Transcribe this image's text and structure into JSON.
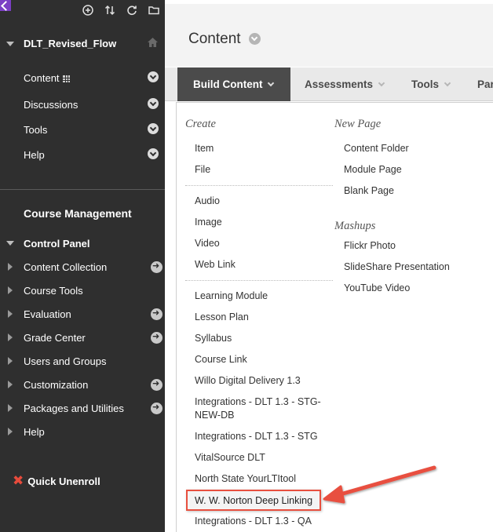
{
  "sidebar": {
    "course_title": "DLT_Revised_Flow",
    "course_menu": [
      {
        "label": "Content"
      },
      {
        "label": "Discussions"
      },
      {
        "label": "Tools"
      },
      {
        "label": "Help"
      }
    ],
    "course_management_title": "Course Management",
    "control_panel_title": "Control Panel",
    "control_panel_items": [
      {
        "label": "Content Collection"
      },
      {
        "label": "Course Tools"
      },
      {
        "label": "Evaluation"
      },
      {
        "label": "Grade Center"
      },
      {
        "label": "Users and Groups"
      },
      {
        "label": "Customization"
      },
      {
        "label": "Packages and Utilities"
      },
      {
        "label": "Help"
      }
    ],
    "quick_unenroll": "Quick Unenroll"
  },
  "main": {
    "page_title": "Content",
    "tabs": [
      {
        "label": "Build Content"
      },
      {
        "label": "Assessments"
      },
      {
        "label": "Tools"
      },
      {
        "label": "Par"
      }
    ]
  },
  "dropdown": {
    "create_heading": "Create",
    "create_group1": [
      "Item",
      "File"
    ],
    "create_group2": [
      "Audio",
      "Image",
      "Video",
      "Web Link"
    ],
    "create_group3": [
      "Learning Module",
      "Lesson Plan",
      "Syllabus",
      "Course Link",
      "Willo Digital Delivery 1.3",
      "Integrations - DLT 1.3 - STG-",
      "NEW-DB",
      "Integrations - DLT 1.3 - STG",
      "VitalSource DLT",
      "North State YourLTItool",
      "W. W. Norton Deep Linking",
      "Integrations - DLT 1.3 - QA"
    ],
    "new_page_heading": "New Page",
    "new_page_items": [
      "Content Folder",
      "Module Page",
      "Blank Page"
    ],
    "mashups_heading": "Mashups",
    "mashups_items": [
      "Flickr Photo",
      "SlideShare Presentation",
      "YouTube Video"
    ]
  },
  "colors": {
    "sidebar_bg": "#2f2f2f",
    "active_tab_bg": "#4b4b4b",
    "callout_red": "#e8503f"
  }
}
